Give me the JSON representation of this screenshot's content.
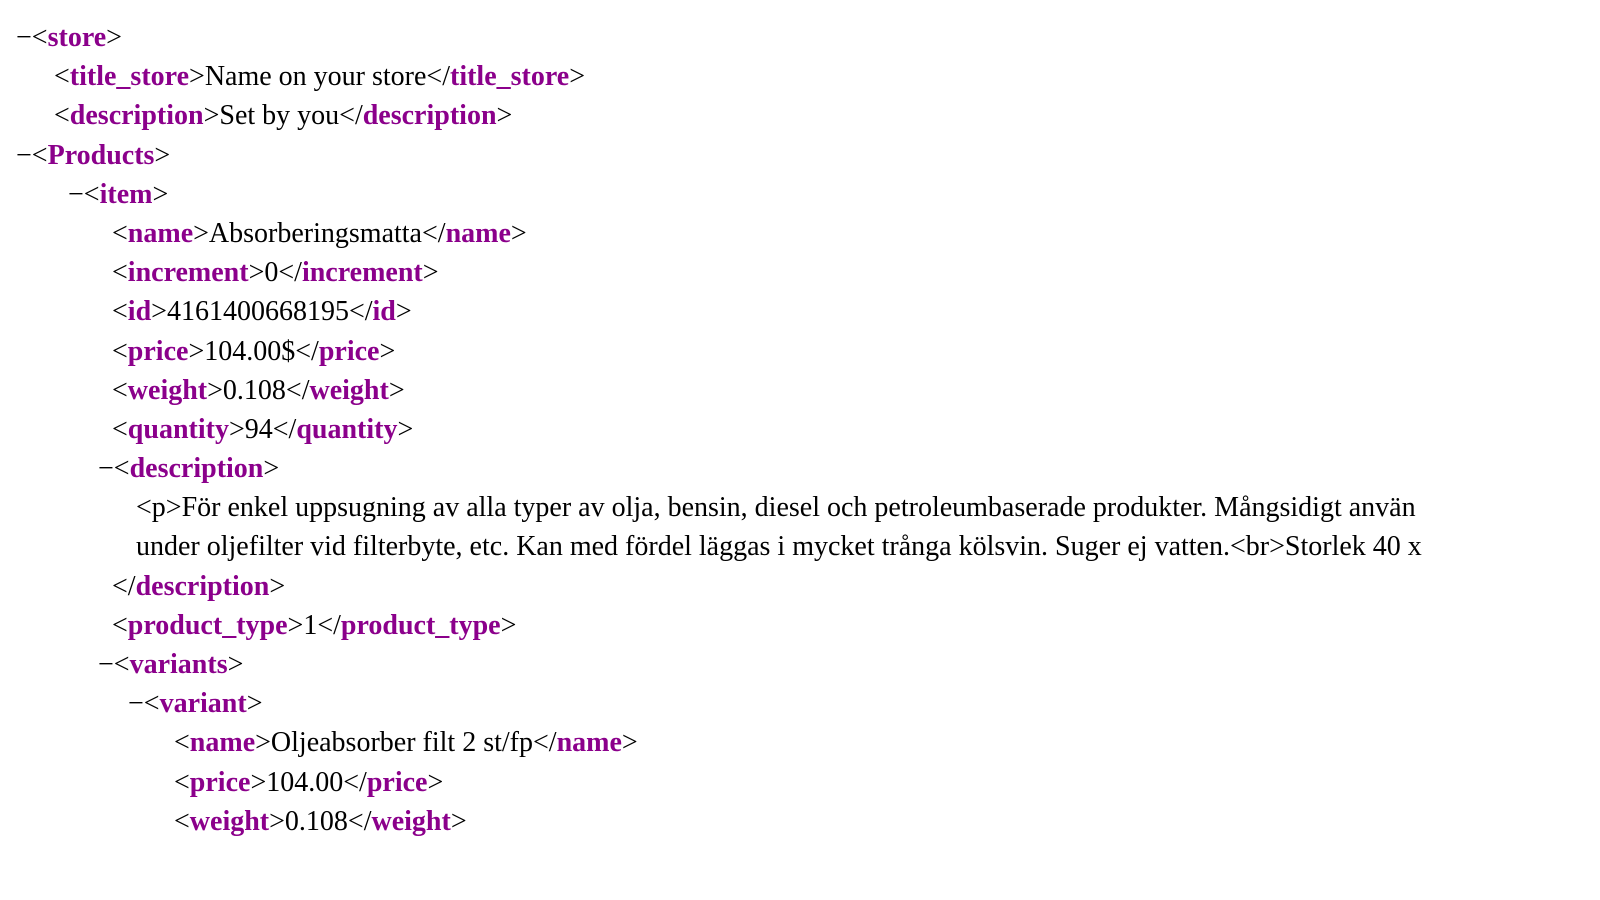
{
  "colors": {
    "tag": "#8b008b",
    "text": "#000000",
    "background": "#ffffff"
  },
  "toggle": "−",
  "xml": {
    "store": {
      "open": "store",
      "title_store": {
        "tag": "title_store",
        "value": "Name on your store"
      },
      "description": {
        "tag": "description",
        "value": "Set by you"
      },
      "products": {
        "open": "Products",
        "item": {
          "open": "item",
          "name": {
            "tag": "name",
            "value": "Absorberingsmatta"
          },
          "increment": {
            "tag": "increment",
            "value": "0"
          },
          "id": {
            "tag": "id",
            "value": "4161400668195"
          },
          "price": {
            "tag": "price",
            "value": "104.00$"
          },
          "weight": {
            "tag": "weight",
            "value": "0.108"
          },
          "quantity": {
            "tag": "quantity",
            "value": "94"
          },
          "description": {
            "open": "description",
            "p_line": "<p>För enkel uppsugning av alla typer av olja, bensin, diesel och petroleumbaserade produkter. Mångsidigt använ",
            "p_line2": "under oljefilter vid filterbyte, etc. Kan med fördel läggas i mycket trånga kölsvin. Suger ej vatten.<br>Storlek 40 x",
            "close": "description"
          },
          "product_type": {
            "tag": "product_type",
            "value": "1"
          },
          "variants": {
            "open": "variants",
            "variant": {
              "open": "variant",
              "name": {
                "tag": "name",
                "value": "Oljeabsorber filt 2 st/fp"
              },
              "price": {
                "tag": "price",
                "value": "104.00"
              },
              "weight": {
                "tag": "weight",
                "value": "0.108"
              }
            }
          }
        }
      }
    }
  }
}
